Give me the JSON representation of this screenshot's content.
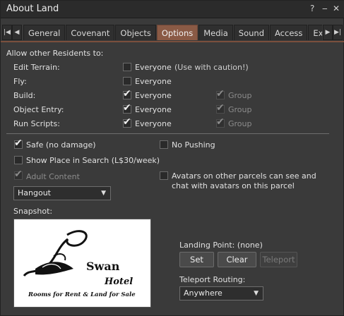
{
  "window": {
    "title": "About Land",
    "help_glyph": "?",
    "minimize_glyph": "‒",
    "close_glyph": "✕"
  },
  "tabs": [
    "General",
    "Covenant",
    "Objects",
    "Options",
    "Media",
    "Sound",
    "Access",
    "Expe"
  ],
  "active_tab": "Options",
  "permissions": {
    "header": "Allow other Residents to:",
    "rows": [
      {
        "label": "Edit Terrain:",
        "everyone": "Everyone",
        "everyone_checked": false,
        "note": "(Use with caution!)"
      },
      {
        "label": "Fly:",
        "everyone": "Everyone",
        "everyone_checked": false
      },
      {
        "label": "Build:",
        "everyone": "Everyone",
        "everyone_checked": true,
        "group": "Group",
        "group_checked": true
      },
      {
        "label": "Object Entry:",
        "everyone": "Everyone",
        "everyone_checked": true,
        "group": "Group",
        "group_checked": true
      },
      {
        "label": "Run Scripts:",
        "everyone": "Everyone",
        "everyone_checked": true,
        "group": "Group",
        "group_checked": true
      }
    ]
  },
  "options": {
    "safe": {
      "label": "Safe (no damage)",
      "checked": true
    },
    "no_pushing": {
      "label": "No Pushing",
      "checked": false
    },
    "show_in_search": {
      "label": "Show Place in Search (L$30/week)",
      "checked": false
    },
    "adult_content": {
      "label": "Adult Content",
      "checked": true,
      "disabled": true
    },
    "avatars_see": {
      "label_line1": "Avatars on other parcels can see and",
      "label_line2": "chat with avatars on this parcel",
      "checked": false
    }
  },
  "category_dropdown": {
    "value": "Hangout"
  },
  "snapshot": {
    "label": "Snapshot:",
    "image_text_1": "Swan",
    "image_text_2": "Hotel",
    "image_text_3": "Rooms for Rent & Land for Sale"
  },
  "landing": {
    "label": "Landing Point: (none)",
    "set": "Set",
    "clear": "Clear",
    "teleport": "Teleport"
  },
  "routing": {
    "label": "Teleport Routing:",
    "value": "Anywhere"
  }
}
